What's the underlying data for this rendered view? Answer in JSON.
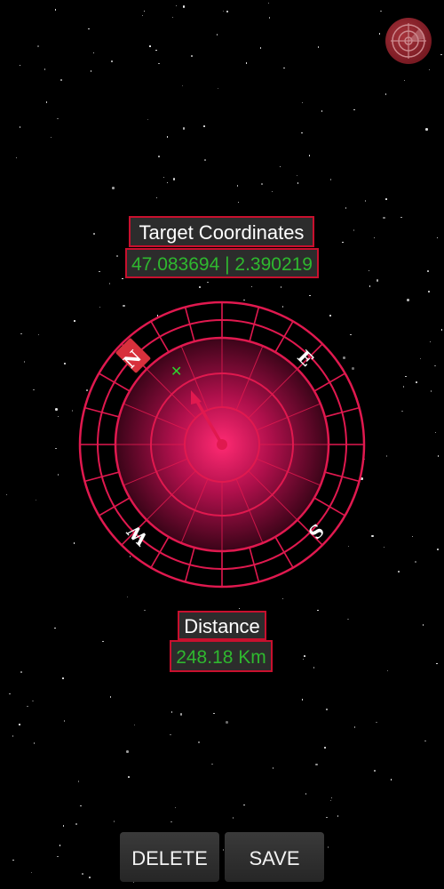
{
  "header": {
    "radar_icon": "radar-icon"
  },
  "target": {
    "title": "Target Coordinates",
    "coordinates": "47.083694 | 2.390219"
  },
  "compass": {
    "directions": {
      "north": "N",
      "east": "E",
      "south": "S",
      "west": "W"
    },
    "accent_color": "#e0194f",
    "north_marker_color": "#d8303c",
    "target_marker": "x-mark-icon",
    "target_marker_color": "#2fd12f"
  },
  "distance": {
    "title": "Distance",
    "value": "248.18 Km"
  },
  "actions": {
    "delete_label": "DELETE",
    "save_label": "SAVE"
  },
  "colors": {
    "background": "#000000",
    "label_background": "#2c2c2c",
    "label_border": "#c8102e",
    "value_text": "#2fb82f"
  }
}
